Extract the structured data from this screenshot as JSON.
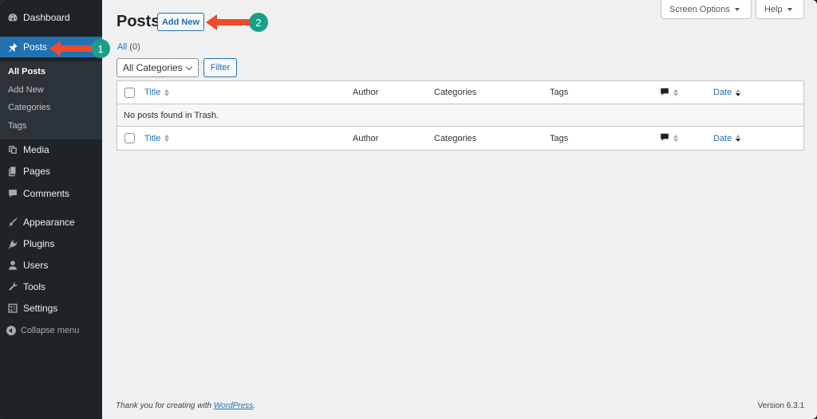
{
  "sidebar": {
    "dashboard": {
      "label": "Dashboard",
      "icon": "dashboard-icon"
    },
    "posts": {
      "label": "Posts",
      "icon": "pin-icon"
    },
    "submenu": [
      "All Posts",
      "Add New",
      "Categories",
      "Tags"
    ],
    "items": [
      {
        "label": "Media",
        "icon": "media-icon"
      },
      {
        "label": "Pages",
        "icon": "pages-icon"
      },
      {
        "label": "Comments",
        "icon": "comment-icon"
      },
      {
        "label": "Appearance",
        "icon": "brush-icon"
      },
      {
        "label": "Plugins",
        "icon": "plugin-icon"
      },
      {
        "label": "Users",
        "icon": "user-icon"
      },
      {
        "label": "Tools",
        "icon": "wrench-icon"
      },
      {
        "label": "Settings",
        "icon": "settings-icon"
      }
    ],
    "collapse": "Collapse menu"
  },
  "header": {
    "title": "Posts",
    "add_new": "Add New",
    "screen_options": "Screen Options",
    "help": "Help"
  },
  "views": {
    "all_label": "All",
    "all_count": "(0)"
  },
  "filters": {
    "category_select": "All Categories",
    "filter_button": "Filter"
  },
  "table": {
    "columns": {
      "title": "Title",
      "author": "Author",
      "categories": "Categories",
      "tags": "Tags",
      "date": "Date"
    },
    "empty_message": "No posts found in Trash."
  },
  "footer": {
    "thanks_prefix": "Thank you for creating with ",
    "wordpress_link": "WordPress",
    "thanks_suffix": ".",
    "version": "Version 6.3.1"
  },
  "annotations": [
    {
      "number": "1",
      "color": "#1a9e8a",
      "arrow_color": "#ee4b2b"
    },
    {
      "number": "2",
      "color": "#1a9e8a",
      "arrow_color": "#ee4b2b"
    }
  ],
  "colors": {
    "accent": "#2271b1",
    "sidebar": "#1d2327",
    "submenu": "#2c3338"
  }
}
